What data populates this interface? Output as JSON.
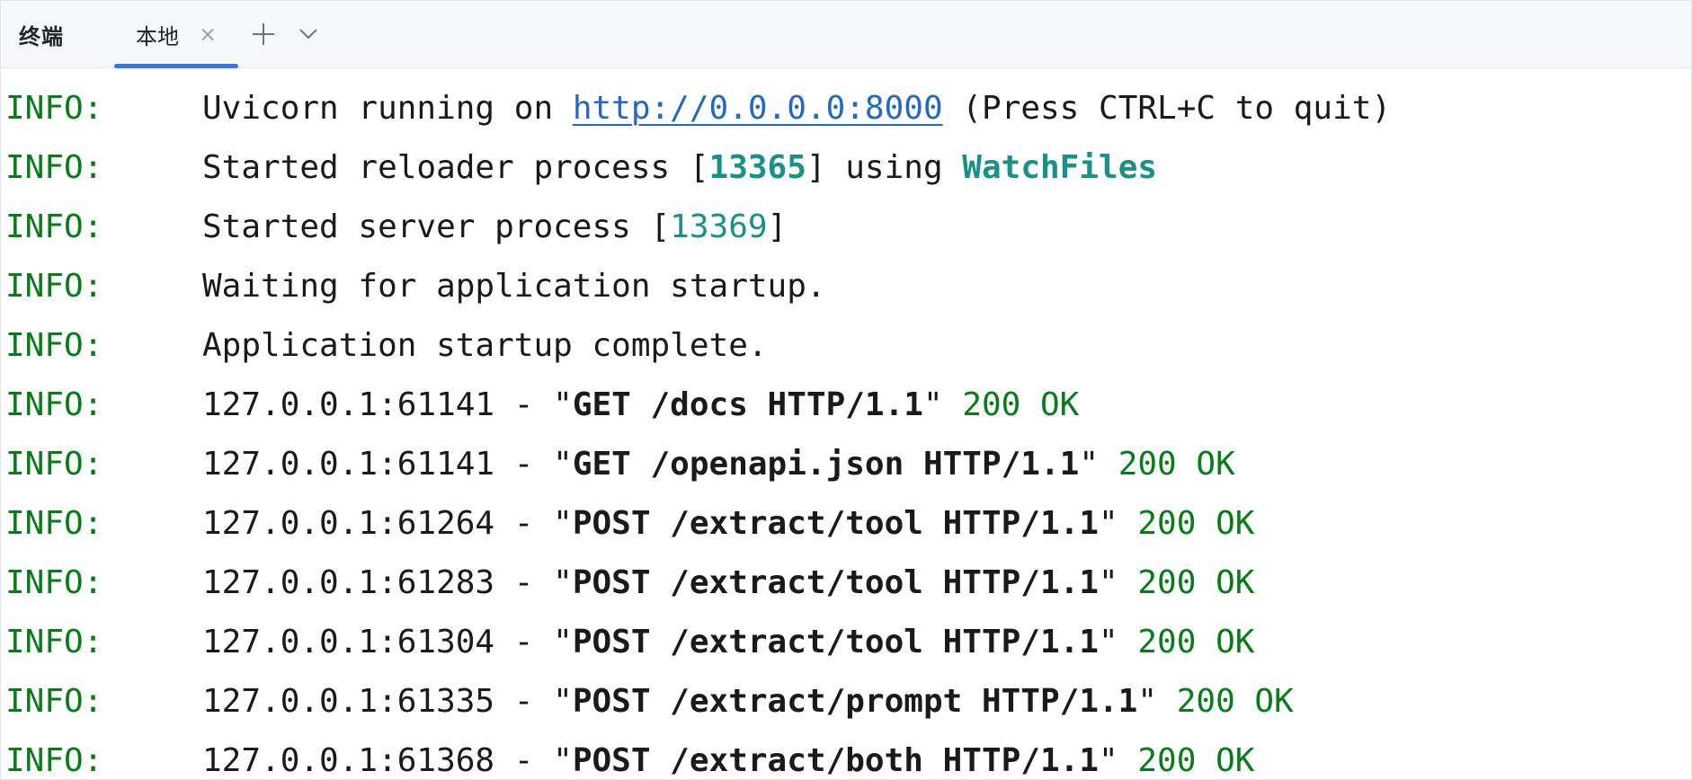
{
  "panel": {
    "title": "终端"
  },
  "tabs": [
    {
      "label": "本地",
      "close_glyph": "×",
      "active": true
    }
  ],
  "icons": {
    "add": "plus-icon",
    "more": "chevron-down-icon",
    "close": "close-icon"
  },
  "colors": {
    "level": "#067d17",
    "link": "#2168c9",
    "number": "#17918a",
    "status": "#067d17",
    "active_tab_underline": "#3574f0"
  },
  "log": {
    "l1": {
      "level": "INFO:",
      "pre": "Uvicorn running on ",
      "url": "http://0.0.0.0:8000",
      "post": " (Press CTRL+C to quit)"
    },
    "l2": {
      "level": "INFO:",
      "pre": "Started reloader process [",
      "pid": "13365",
      "mid": "] using ",
      "tool": "WatchFiles"
    },
    "l3": {
      "level": "INFO:",
      "pre": "Started server process [",
      "pid": "13369",
      "post": "]"
    },
    "l4": {
      "level": "INFO:",
      "text": "Waiting for application startup."
    },
    "l5": {
      "level": "INFO:",
      "text": "Application startup complete."
    },
    "requests": [
      {
        "level": "INFO:",
        "client": "127.0.0.1:61141",
        "request": "GET /docs HTTP/1.1",
        "status": "200 OK"
      },
      {
        "level": "INFO:",
        "client": "127.0.0.1:61141",
        "request": "GET /openapi.json HTTP/1.1",
        "status": "200 OK"
      },
      {
        "level": "INFO:",
        "client": "127.0.0.1:61264",
        "request": "POST /extract/tool HTTP/1.1",
        "status": "200 OK"
      },
      {
        "level": "INFO:",
        "client": "127.0.0.1:61283",
        "request": "POST /extract/tool HTTP/1.1",
        "status": "200 OK"
      },
      {
        "level": "INFO:",
        "client": "127.0.0.1:61304",
        "request": "POST /extract/tool HTTP/1.1",
        "status": "200 OK"
      },
      {
        "level": "INFO:",
        "client": "127.0.0.1:61335",
        "request": "POST /extract/prompt HTTP/1.1",
        "status": "200 OK"
      },
      {
        "level": "INFO:",
        "client": "127.0.0.1:61368",
        "request": "POST /extract/both HTTP/1.1",
        "status": "200 OK"
      }
    ]
  }
}
